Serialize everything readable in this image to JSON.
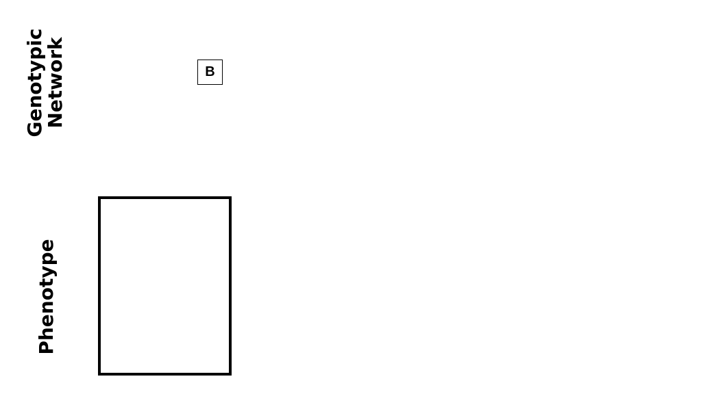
{
  "labels": {
    "genotypic_line1": "Genotypic",
    "genotypic_line2": "Network",
    "phenotype": "Phenotype"
  },
  "panel": {
    "badge": "B"
  }
}
